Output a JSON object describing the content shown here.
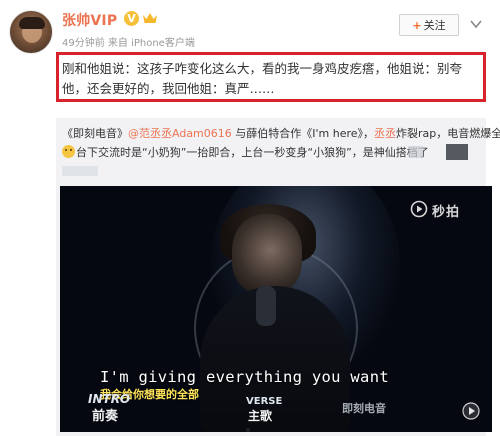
{
  "post": {
    "author_name": "张帅VIP",
    "vip_badge": "V",
    "meta": "49分钟前 来自 iPhone客户端",
    "follow_label": "关注",
    "follow_plus": "+",
    "text": "刚和他姐说：这孩子咋变化这么大，看的我一身鸡皮疙瘩，他姐说：别夸他，还会更好的，我回他姐：真严……"
  },
  "repost": {
    "line1_prefix": "《即刻电音》",
    "mention_1": "@范丞丞Adam0616",
    "line1_mid": " 与薛伯特合作《I'm here》，",
    "mention_2": "丞丞",
    "line1_suffix": "炸裂rap，电音燃爆全场",
    "line2_rest": "台下交流时是“小奶狗”一抬即合，上台一秒变身“小狼狗”，是神仙搭档了"
  },
  "video": {
    "watermark": "秒拍",
    "subtitle_en": "I'm giving everything you want",
    "subtitle_cn": "我会给你想要的全部",
    "tag_left_top": "INTRO",
    "tag_left_bottom": "前奏",
    "tag_mid_top": "VERSE",
    "tag_mid_bottom": "主歌",
    "tag_right": "即刻电音"
  },
  "colors": {
    "accent": "#eb7350",
    "highlight_border": "#d8232a",
    "repost_bg": "#f2f2f5",
    "subtitle_cn": "#ffe35a"
  }
}
